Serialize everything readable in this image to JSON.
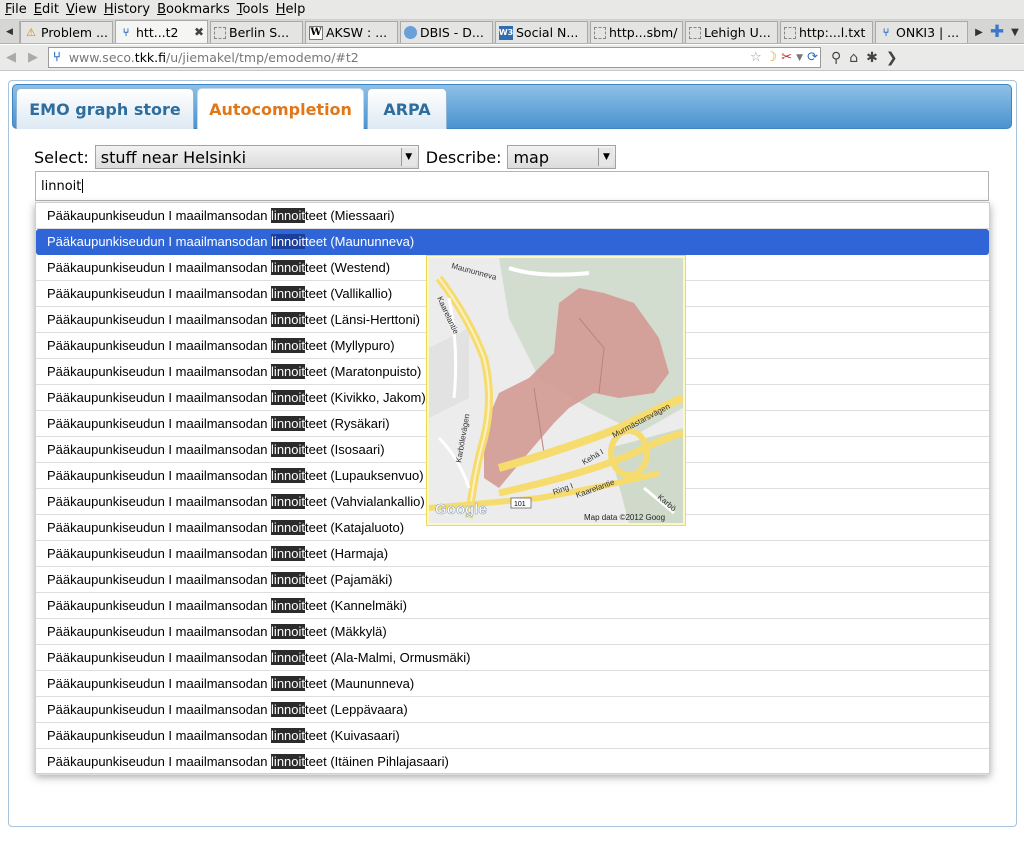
{
  "menubar": {
    "items": [
      "File",
      "Edit",
      "View",
      "History",
      "Bookmarks",
      "Tools",
      "Help"
    ]
  },
  "tabs": [
    {
      "label": "Problem ...",
      "icon": "warning-icon"
    },
    {
      "label": "htt...t2",
      "icon": "seco-favicon-icon",
      "active": true
    },
    {
      "label": "Berlin S...",
      "icon": "page-icon"
    },
    {
      "label": "AKSW : ...",
      "icon": "wikipedia-icon"
    },
    {
      "label": "DBIS - D...",
      "icon": "globe-icon"
    },
    {
      "label": "Social N...",
      "icon": "w3c-icon"
    },
    {
      "label": "http...sbm/",
      "icon": "page-icon"
    },
    {
      "label": "Lehigh U...",
      "icon": "page-icon"
    },
    {
      "label": "http:...l.txt",
      "icon": "page-icon"
    },
    {
      "label": "ONKI3 | ...",
      "icon": "seco-favicon-icon"
    }
  ],
  "navbar": {
    "url_prefix": "www.seco.",
    "url_domain": "tkk.fi",
    "url_rest": "/u/jiemakel/tmp/emodemo/#t2"
  },
  "app": {
    "tabs": [
      "EMO graph store",
      "Autocompletion",
      "ARPA"
    ],
    "active_tab": "Autocompletion",
    "select_label": "Select:",
    "select_value": "stuff near Helsinki",
    "describe_label": "Describe:",
    "describe_value": "map",
    "search_value": "linnoit"
  },
  "results": {
    "prefix": "Pääkaupunkiseudun I maailmansodan ",
    "match": "linnoit",
    "suffix_base": "teet",
    "selected_index": 1,
    "items": [
      "Miessaari",
      "Maununneva",
      "Westend",
      "Vallikallio",
      "Länsi-Herttoni",
      "Myllypuro",
      "Maratonpuisto",
      "Kivikko, Jakom",
      "Rysäkari",
      "Isosaari",
      "Lupauksenvuo",
      "Vahvialankallio",
      "Katajaluoto",
      "Harmaja",
      "Pajamäki",
      "Kannelmäki",
      "Mäkkylä",
      "Ala-Malmi, Ormusmäki",
      "Maununneva",
      "Leppävaara",
      "Kuivasaari",
      "Itäinen Pihlajasaari"
    ]
  },
  "map": {
    "labels": [
      "Maununneva",
      "Kaarelantie",
      "Karbölevägen",
      "Murmästarsvägen",
      "Kehä I",
      "Ring I",
      "Kaarelantie",
      "Karbö",
      "101"
    ],
    "logo": "Google",
    "attribution": "Map data ©2012 Goog"
  }
}
